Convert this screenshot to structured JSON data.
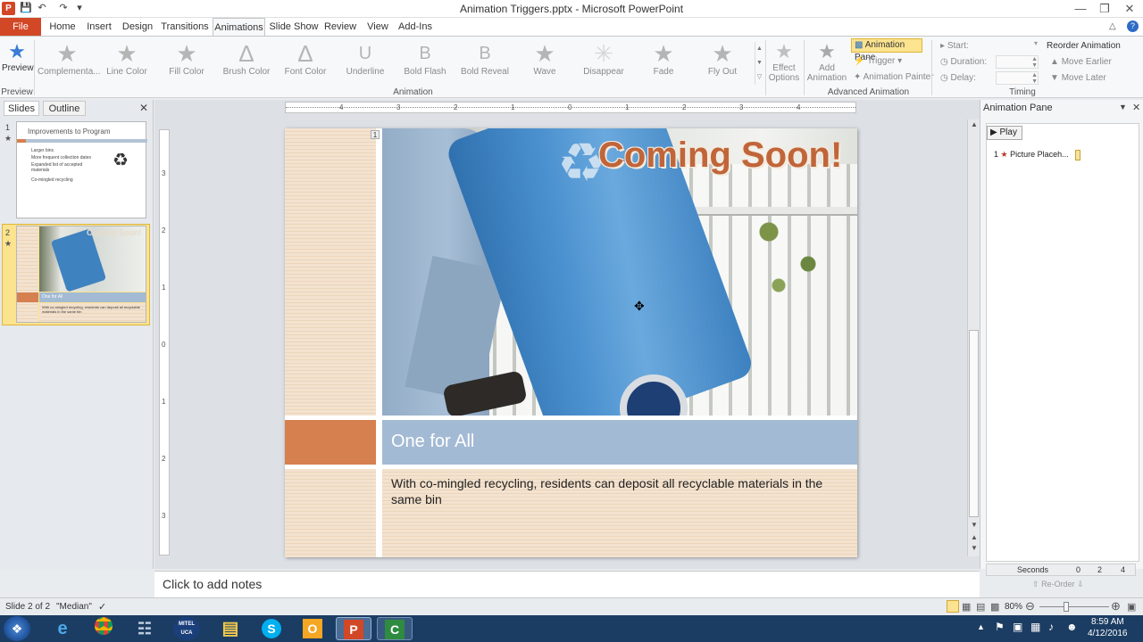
{
  "window": {
    "title": "Animation Triggers.pptx - Microsoft PowerPoint"
  },
  "tabs": [
    "File",
    "Home",
    "Insert",
    "Design",
    "Transitions",
    "Animations",
    "Slide Show",
    "Review",
    "View",
    "Add-Ins"
  ],
  "ribbon": {
    "preview_label": "Preview",
    "preview_group": "Preview",
    "animation_group": "Animation",
    "effects": [
      "Complementa...",
      "Line Color",
      "Fill Color",
      "Brush Color",
      "Font Color",
      "Underline",
      "Bold Flash",
      "Bold Reveal",
      "Wave",
      "Disappear",
      "Fade",
      "Fly Out"
    ],
    "effect_options": [
      "Effect",
      "Options"
    ],
    "add_animation": [
      "Add",
      "Animation"
    ],
    "animation_pane_btn": "Animation Pane",
    "trigger_btn": "Trigger",
    "animation_painter_btn": "Animation Painter",
    "advanced_group": "Advanced Animation",
    "start_label": "Start:",
    "duration_label": "Duration:",
    "delay_label": "Delay:",
    "reorder_label": "Reorder Animation",
    "move_earlier": "Move Earlier",
    "move_later": "Move Later",
    "timing_group": "Timing"
  },
  "leftpane": {
    "tabs": [
      "Slides",
      "Outline"
    ],
    "slide1": {
      "num": "1",
      "title": "Improvements to Program",
      "bullets": [
        "Larger bins",
        "More frequent collection dates",
        "Expanded list of accepted materials",
        "Co-mingled recycling"
      ]
    },
    "slide2": {
      "num": "2",
      "title": "Coming Soon!",
      "subtitle": "One for All",
      "body": "With co-mingled recycling, residents can deposit all recyclable materials in the same bin"
    }
  },
  "ruler": {
    "h": [
      "4",
      "3",
      "2",
      "1",
      "0",
      "1",
      "2",
      "3",
      "4"
    ],
    "v": [
      "3",
      "2",
      "1",
      "0",
      "1",
      "2",
      "3"
    ]
  },
  "slide": {
    "marker": "1",
    "heading": "Coming Soon!",
    "subtitle": "One for All",
    "body": "With co-mingled recycling, residents can deposit all recyclable materials in the same bin"
  },
  "animpane": {
    "title": "Animation Pane",
    "play": "Play",
    "items": [
      {
        "num": "1",
        "label": "Picture Placeh..."
      }
    ],
    "seconds": "Seconds",
    "timeline": [
      "0",
      "2",
      "4"
    ],
    "reorder": "Re-Order"
  },
  "notes": {
    "placeholder": "Click to add notes"
  },
  "status": {
    "slide": "Slide 2 of 2",
    "theme": "\"Median\"",
    "zoom": "80%"
  },
  "taskbar": {
    "time": "8:59 AM",
    "date": "4/12/2016",
    "mitel": "MITEL UCA"
  },
  "colors": {
    "file_tab": "#d24726",
    "orange_block": "#d6804f",
    "subtitle_bar": "#a3bad4",
    "heading_text": "#c0653a",
    "taskbar": "#1c3d63"
  }
}
